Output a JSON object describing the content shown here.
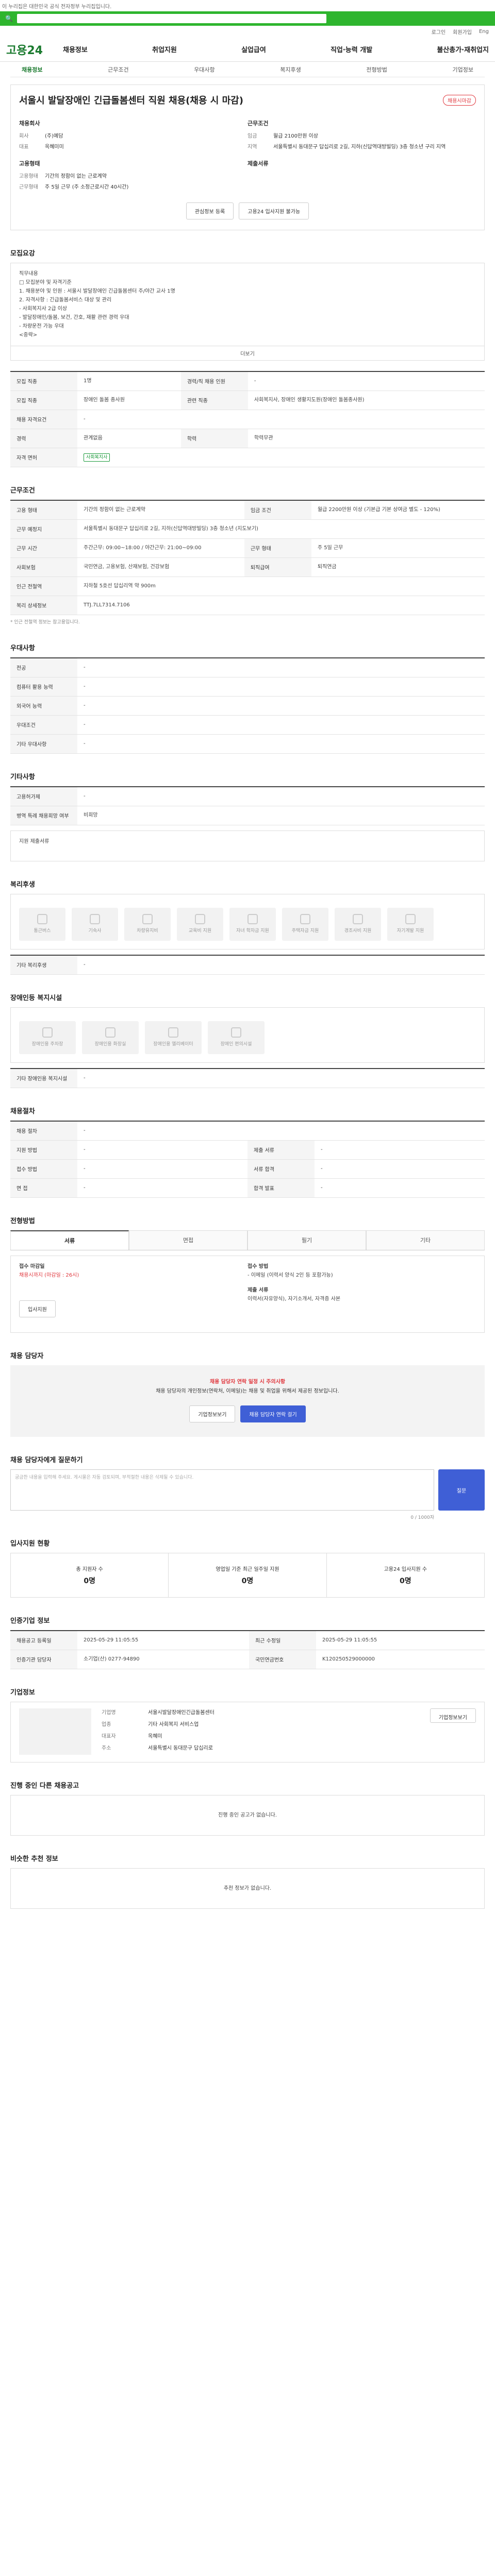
{
  "topbar": {
    "notice": "이 누리집은 대한민국 공식 전자정부 누리집입니다."
  },
  "util": [
    "로그인",
    "회원가입",
    "Eng"
  ],
  "gnb": {
    "logo": "고용24",
    "menu": [
      "채용정보",
      "취업지원",
      "실업급여",
      "직업·능력 개발",
      "불산총가·재취업지"
    ]
  },
  "subnav": [
    "채용정보",
    "근무조건",
    "우대사항",
    "복지후생",
    "전형방법",
    "기업정보"
  ],
  "job": {
    "title": "서울시 발달장애인 긴급돌봄센터 직원 채용(채용 시 마감)",
    "badge": "채용시마감",
    "company_h": "채용회사",
    "co_rows": [
      [
        "회사",
        "(주)예담"
      ],
      [
        "대표",
        "옥혜미미"
      ]
    ],
    "cond_h": "근무조건",
    "cond_rows": [
      [
        "임금",
        "월급 2100만원 이상"
      ],
      [
        "지역",
        "서울특별시 동대문구 답십리로 2길, 지하(신답역대방빌딩) 3층 청소년 구리 지역"
      ]
    ],
    "req_h": "고용형태",
    "req_rows": [
      [
        "고용형태",
        "기간의 정함이 없는 근로계약"
      ],
      [
        "근무형태",
        "주 5일 근무 (주 소정근로시간 40시간)"
      ]
    ],
    "pay_h": "제출서류",
    "btn_save": "관심정보 등록",
    "btn_apply": "고용24 입사지원 불가능"
  },
  "recruit": {
    "h": "모집요강",
    "intro": [
      "직무내용",
      "□ 모집분야 및 자격기준",
      "1. 채용분야 및 인원 : 서울시 발달장애인 긴급돌봄센터 주/야간 교사 1명",
      "2. 자격사항 : 긴급돌봄서비스 대상 및 관리",
      "- 사회복지사 2급 이상",
      "- 발달장애인/돌봄, 보건, 간호, 재활 관련 경력 우대",
      "- 차량운전 가능 우대",
      "<중략>"
    ],
    "more": "더보기"
  },
  "rec_tbl": [
    [
      "모집 직종",
      "1명",
      "경력/직 채용 인원",
      "-"
    ],
    [
      "모집 직종",
      "장애인 돌봄 종사원",
      "관련 직종",
      "사회복지사, 장애인 생활지도원(장애인 돌봄종사원)"
    ],
    [
      "채용 자격요건",
      "-",
      "",
      ""
    ],
    [
      "경력",
      "관계없음",
      "학력",
      "학력무관"
    ],
    [
      "자격 면허",
      "사회복지사",
      "",
      ""
    ]
  ],
  "work": {
    "h": "근무조건",
    "rows": [
      [
        "고용 형태",
        "기간의 정함이 없는 근로계약",
        "임금 조건",
        "월급 2200만원 이상 (기본급 기본 상여금 별도 - 120%)"
      ],
      [
        "근무 예정지",
        "서울특별시 동대문구 답십리로 2길, 지하(신답역대방빌딩) 3층 청소년 (지도보기)",
        "",
        ""
      ],
      [
        "근무 시간",
        "주간근무: 09:00~18:00 / 야간근무: 21:00~09:00",
        "근무 형태",
        "주 5일 근무"
      ],
      [
        "사회보험",
        "국민연금, 고용보험, 산재보험, 건강보험",
        "퇴직급여",
        "퇴직연금"
      ],
      [
        "인근 전철역",
        "지하철 5호선 답십리역 약 900m",
        "",
        ""
      ],
      [
        "복리 상세정보",
        "TTJ.7LL7314.7106",
        "",
        ""
      ]
    ],
    "note": "* 인근 전철역 정보는 참고용입니다."
  },
  "prefer": {
    "h": "우대사항",
    "rows": [
      [
        "전공",
        "-"
      ],
      [
        "컴퓨터 활용 능력",
        "-"
      ],
      [
        "외국어 능력",
        "-"
      ],
      [
        "우대조건",
        "-"
      ],
      [
        "기타 우대사항",
        "-"
      ]
    ]
  },
  "etc": {
    "h": "기타사항",
    "rows": [
      [
        "고용허가제",
        "-"
      ],
      [
        "병역 특례 채용희망 여부",
        "비희망"
      ]
    ],
    "hint": "지원 제출서류"
  },
  "welfare": {
    "h": "복리후생",
    "items": [
      "통근버스",
      "기숙사",
      "차량유지비",
      "교육비 지원",
      "자녀 학자금 지원",
      "주택자금 지원",
      "경조사비 지원",
      "자기계발 지원"
    ],
    "etc_h": "기타 복리후생",
    "etc_v": "-"
  },
  "disabled": {
    "h": "장애인등 복지시설",
    "items": [
      "장애인용 주차장",
      "장애인용 화장실",
      "장애인용 엘리베이터",
      "장애인 편의시설"
    ],
    "etc_h": "기타 장애인용 복지시설",
    "etc_v": "-"
  },
  "selection": {
    "h": "채용절차",
    "rows": [
      [
        "채용 절차",
        "-",
        "",
        " "
      ],
      [
        "지원 방법",
        "-",
        "제출 서류",
        "-"
      ],
      [
        "접수 방법",
        "-",
        "서류 합격",
        "-"
      ],
      [
        "면 접",
        "-",
        "합격 발표",
        "-"
      ]
    ]
  },
  "method": {
    "h": "전형방법",
    "tabs": [
      "서류",
      "면접",
      "필기",
      "기타"
    ],
    "rows": [
      [
        "접수 마감일",
        "채용시까지 (마감일 : 26시)",
        "접수 방법",
        "- 이메일 (이력서 양식 2인 등 포함가능)"
      ],
      [
        "",
        "",
        "제출 서류",
        "이력서(자유양식), 자기소개서, 자격증 사본"
      ]
    ],
    "btn": "입사지원"
  },
  "contact": {
    "h": "채용 담당자",
    "warn": "채용 담당자 연락 일정 시 주의사항",
    "txt": "채용 담당자의 개인정보(연락처, 이메일)는 채용 및 취업을 위해서 제공된 정보입니다.",
    "btns": [
      "기업정보보기",
      "채용 담당자 연락 걸기"
    ]
  },
  "qna": {
    "h": "채용 담당자에게 질문하기",
    "placeholder": "궁금한 내용을 입력해 주세요. 게시물은 자동 검토되며, 부적절한 내용은 삭제될 수 있습니다.",
    "count": "0 / 1000자",
    "submit": "질문"
  },
  "status": {
    "h": "입사지원 현황",
    "items": [
      [
        "총 지원자 수",
        "0명"
      ],
      [
        "영업일 기준 최근 일주일 지원",
        "0명"
      ],
      [
        "고용24 입사지원 수",
        "0명"
      ]
    ]
  },
  "info": {
    "h": "인증기업 정보",
    "rows": [
      [
        "채용공고 등록일",
        "2025-05-29 11:05:55",
        "최근 수정일",
        "2025-05-29 11:05:55"
      ],
      [
        "인증기관 담당자",
        "소기업(산) 0277-94890",
        "국민연금번호",
        "K120250529000000"
      ]
    ]
  },
  "company": {
    "h": "기업정보",
    "btn": "기업정보보기",
    "rows": [
      [
        "기업명",
        "서울시발달장애인긴급돌봄센터"
      ],
      [
        "업종",
        "기타 사회복지 서비스업"
      ],
      [
        "대표자",
        "옥혜미"
      ],
      [
        "주소",
        "서울특별시 동대문구 답십리로"
      ]
    ]
  },
  "others": {
    "h": "진행 중인 다른 채용공고",
    "empty": "진행 중인 공고가 없습니다."
  },
  "nearby": {
    "h": "비슷한 추천 정보",
    "empty": "추천 정보가 없습니다."
  }
}
